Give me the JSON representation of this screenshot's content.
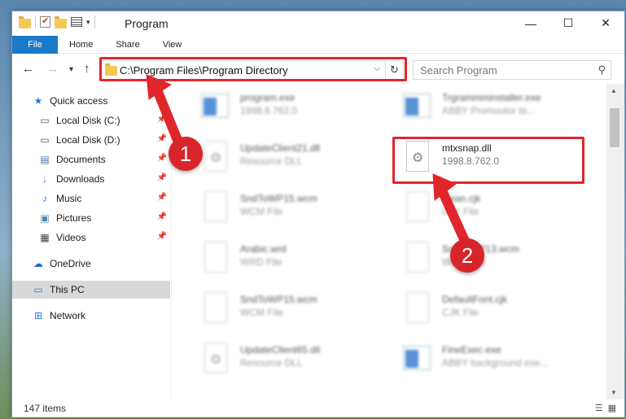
{
  "window": {
    "title": "Program",
    "controls": {
      "minimize": "—",
      "maximize": "☐",
      "close": "✕"
    }
  },
  "ribbon": {
    "tabs": [
      "File",
      "Home",
      "Share",
      "View"
    ]
  },
  "navbar": {
    "address": "C:\\Program Files\\Program Directory",
    "search_placeholder": "Search Program"
  },
  "sidebar": {
    "items": [
      {
        "label": "Quick access",
        "icon": "star-icon"
      },
      {
        "label": "Local Disk (C:)",
        "icon": "drive-icon",
        "pinned": true
      },
      {
        "label": "Local Disk (D:)",
        "icon": "drive-icon",
        "pinned": true
      },
      {
        "label": "Documents",
        "icon": "documents-icon",
        "pinned": true
      },
      {
        "label": "Downloads",
        "icon": "download-icon",
        "pinned": true
      },
      {
        "label": "Music",
        "icon": "music-icon",
        "pinned": true
      },
      {
        "label": "Pictures",
        "icon": "pictures-icon",
        "pinned": true
      },
      {
        "label": "Videos",
        "icon": "videos-icon",
        "pinned": true
      },
      {
        "label": "OneDrive",
        "icon": "cloud-icon"
      },
      {
        "label": "This PC",
        "icon": "pc-icon",
        "selected": true
      },
      {
        "label": "Network",
        "icon": "network-icon"
      }
    ]
  },
  "files": [
    {
      "name": "program.exe",
      "sub": "1998.8.762.0",
      "type": "exe",
      "blurred": true
    },
    {
      "name": "Trgrammminstaller.exe",
      "sub": "ABBY Promoutor bi...",
      "type": "exe",
      "blurred": true
    },
    {
      "name": "UpdateClient21.dll",
      "sub": "Resource DLL",
      "type": "dll",
      "blurred": true
    },
    {
      "name": "mtxsnap.dll",
      "sub": "1998.8.762.0",
      "type": "dll",
      "blurred": false
    },
    {
      "name": "SndToWP15.wcm",
      "sub": "WCM File",
      "type": "doc",
      "blurred": true
    },
    {
      "name": "Gean.cjk",
      "sub": "CJK File",
      "type": "doc",
      "blurred": true
    },
    {
      "name": "Arabic.wrd",
      "sub": "WRD File",
      "type": "doc",
      "blurred": true
    },
    {
      "name": "SndToWP13.wcm",
      "sub": "WCM File",
      "type": "doc",
      "blurred": true
    },
    {
      "name": "SndToWP15.wcm",
      "sub": "WCM File",
      "type": "doc",
      "blurred": true
    },
    {
      "name": "DefaultFont.cjk",
      "sub": "CJK File",
      "type": "doc",
      "blurred": true
    },
    {
      "name": "UpdateClient65.dll",
      "sub": "Resource DLL",
      "type": "dll",
      "blurred": true
    },
    {
      "name": "FineExec.exe",
      "sub": "ABBY background exe...",
      "type": "exe",
      "blurred": true
    }
  ],
  "status": {
    "count": "147 items"
  },
  "annotations": {
    "step1": "1",
    "step2": "2",
    "color": "#e0262b"
  }
}
